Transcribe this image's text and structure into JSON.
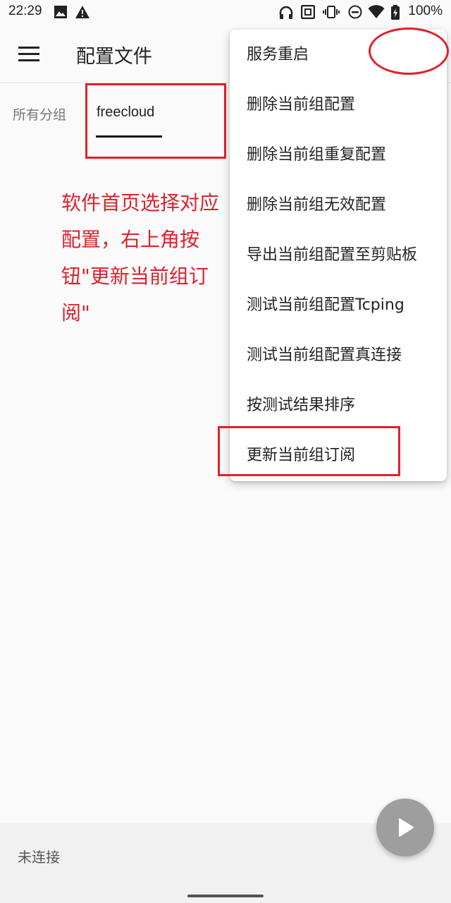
{
  "status_bar": {
    "time": "22:29",
    "battery": "100%",
    "icons": [
      "image-icon",
      "warning-icon",
      "headset-icon",
      "nfc-icon",
      "vibrate-icon",
      "dnd-icon",
      "wifi-icon",
      "battery-icon"
    ]
  },
  "app_bar": {
    "title": "配置文件",
    "menu_icon": "hamburger-menu-icon"
  },
  "tabs": [
    {
      "label": "所有分组",
      "selected": false
    },
    {
      "label": "freecloud",
      "selected": true
    }
  ],
  "annotation": {
    "text": "软件首页选择对应配置，右上角按钮\"更新当前组订阅\"",
    "color": "#d9232d"
  },
  "overflow_menu": {
    "items": [
      {
        "label": "服务重启"
      },
      {
        "label": "删除当前组配置"
      },
      {
        "label": "删除当前组重复配置"
      },
      {
        "label": "删除当前组无效配置"
      },
      {
        "label": "导出当前组配置至剪贴板"
      },
      {
        "label": "测试当前组配置Tcping"
      },
      {
        "label": "测试当前组配置真连接"
      },
      {
        "label": "按测试结果排序"
      },
      {
        "label": "更新当前组订阅"
      }
    ]
  },
  "bottom_bar": {
    "status": "未连接",
    "fab_icon": "play-icon"
  },
  "colors": {
    "highlight": "#e0212a",
    "fab": "#9e9e9e"
  }
}
